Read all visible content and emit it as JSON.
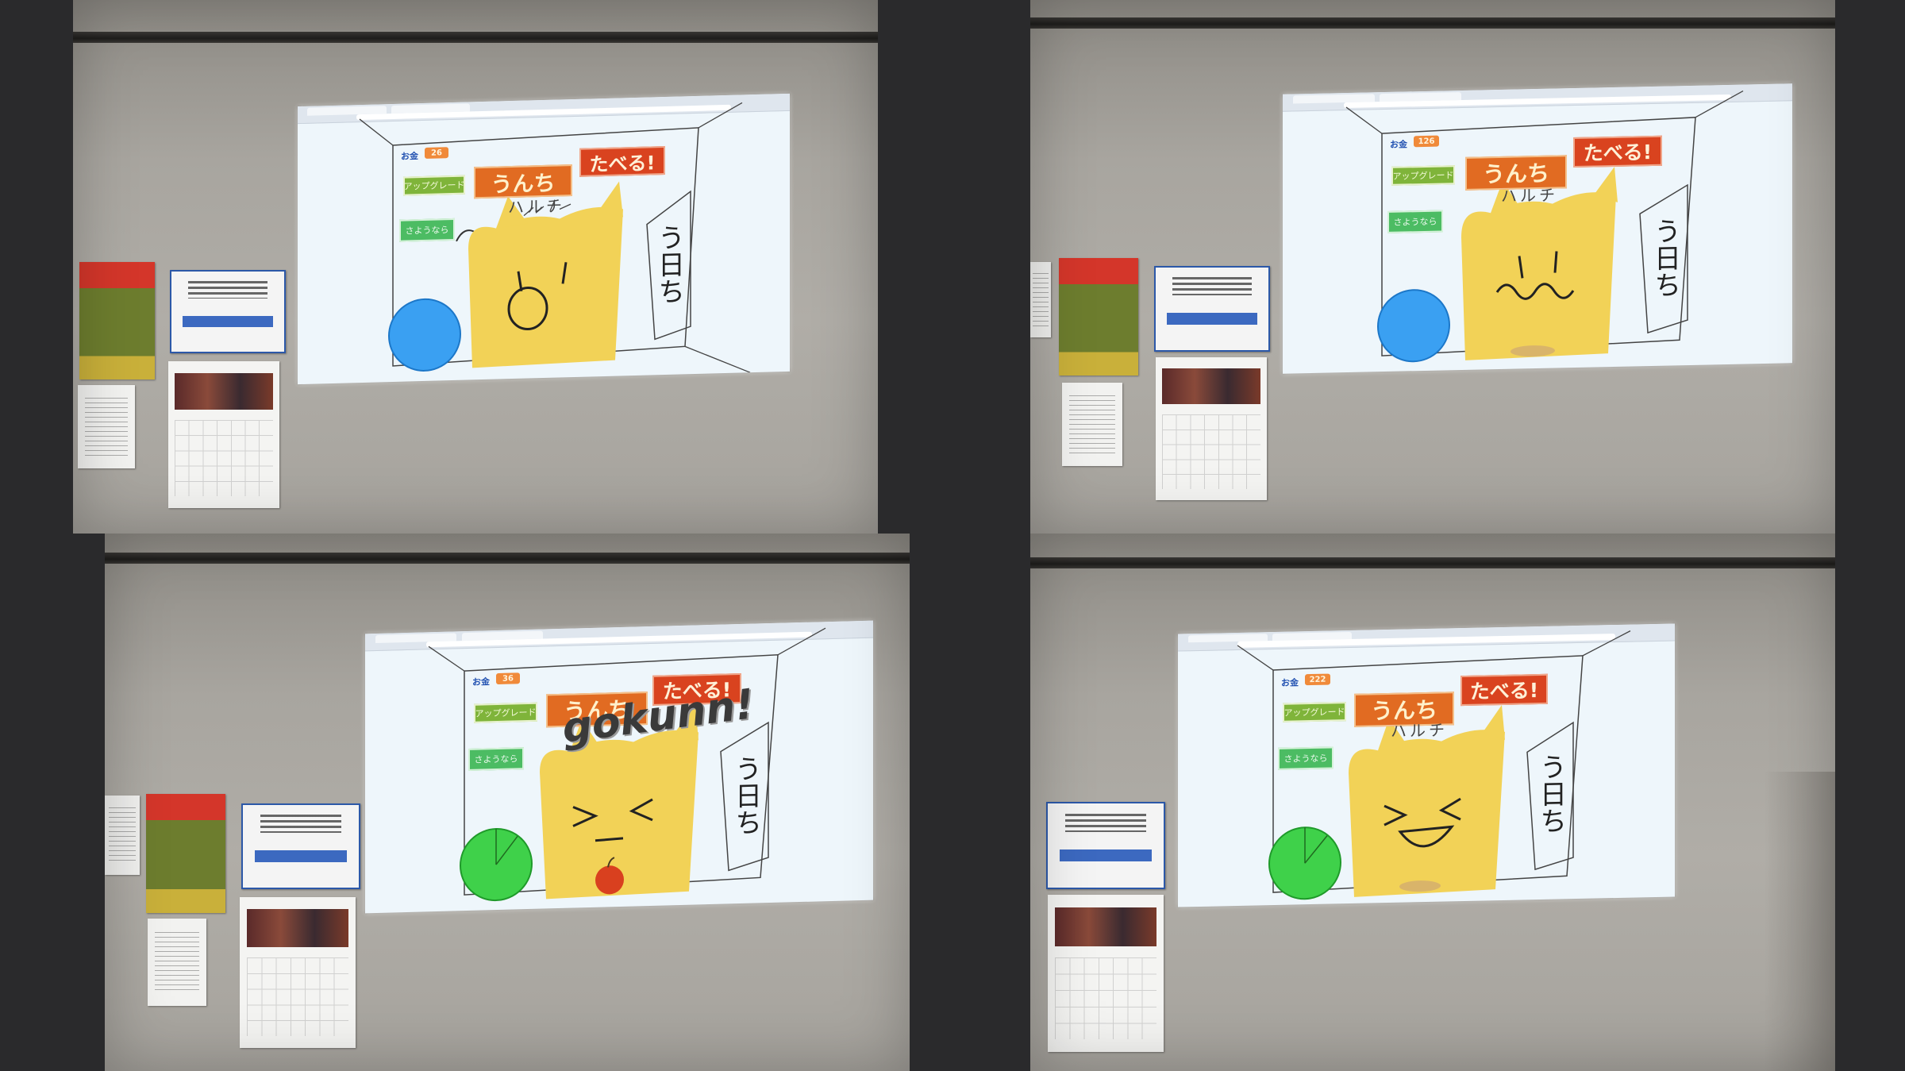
{
  "game": {
    "score_label": "お金",
    "upgrade_button": "アップグレード",
    "title_left": "うんち",
    "title_right": "たべる!",
    "sayonara_button": "さようなら",
    "wall_text_top": "ハルチ",
    "wall_text_right": "う日ち",
    "gokun_text": "gokunn!"
  },
  "panels": [
    {
      "score": "26",
      "timer_color": "#3aa0f2",
      "expression": "surprised"
    },
    {
      "score": "126",
      "timer_color": "#3aa0f2",
      "expression": "wavy"
    },
    {
      "score": "36",
      "timer_color": "#3fd14a",
      "expression": "squint"
    },
    {
      "score": "222",
      "timer_color": "#3fd14a",
      "expression": "laugh"
    }
  ],
  "colors": {
    "cat": "#f2d257",
    "apple": "#d9401f",
    "cookie": "#d9b46a"
  }
}
